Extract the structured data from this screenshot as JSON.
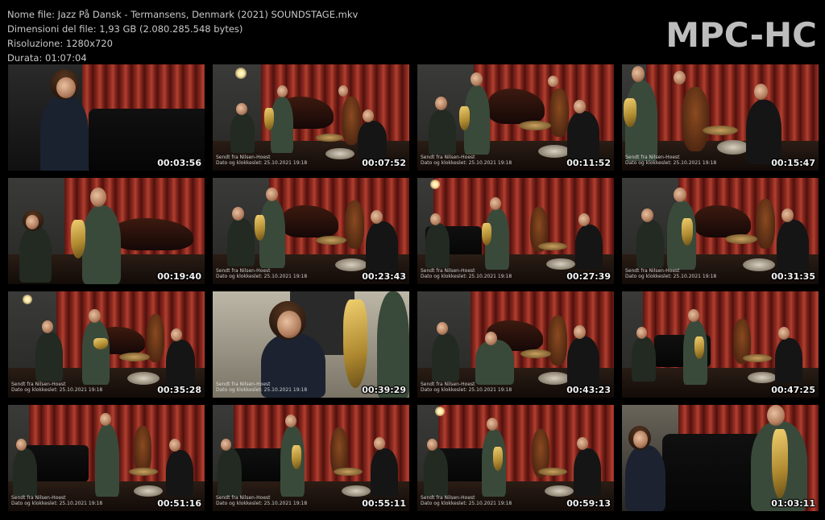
{
  "header": {
    "filename_line": "Nome file: Jazz På Dansk - Termansens, Denmark (2021) SOUNDSTAGE.mkv",
    "filesize_line": "Dimensioni del file: 1,93 GB (2.080.285.548 bytes)",
    "resolution_line": "Risoluzione: 1280x720",
    "duration_line": "Durata: 01:07:04"
  },
  "logo": {
    "text": "MPC-HC",
    "color": "#bdbdbd"
  },
  "thumbnails": [
    {
      "timestamp": "00:03:56"
    },
    {
      "timestamp": "00:07:52",
      "caption1": "Sendt fra Nilsen-Hoest",
      "caption2": "Dato og klokkeslet: 25.10.2021 19:18"
    },
    {
      "timestamp": "00:11:52",
      "caption1": "Sendt fra Nilsen-Hoest",
      "caption2": "Dato og klokkeslet: 25.10.2021 19:18"
    },
    {
      "timestamp": "00:15:47",
      "caption1": "Sendt fra Nilsen-Hoest",
      "caption2": "Dato og klokkeslet: 25.10.2021 19:18"
    },
    {
      "timestamp": "00:19:40"
    },
    {
      "timestamp": "00:23:43",
      "caption1": "Sendt fra Nilsen-Hoest",
      "caption2": "Dato og klokkeslet: 25.10.2021 19:18"
    },
    {
      "timestamp": "00:27:39",
      "caption1": "Sendt fra Nilsen-Hoest",
      "caption2": "Dato og klokkeslet: 25.10.2021 19:18"
    },
    {
      "timestamp": "00:31:35",
      "caption1": "Sendt fra Nilsen-Hoest",
      "caption2": "Dato og klokkeslet: 25.10.2021 19:18"
    },
    {
      "timestamp": "00:35:28",
      "caption1": "Sendt fra Nilsen-Hoest",
      "caption2": "Dato og klokkeslet: 25.10.2021 19:18"
    },
    {
      "timestamp": "00:39:29",
      "caption1": "Sendt fra Nilsen-Hoest",
      "caption2": "Dato og klokkeslet: 25.10.2021 19:18"
    },
    {
      "timestamp": "00:43:23",
      "caption1": "Sendt fra Nilsen-Hoest",
      "caption2": "Dato og klokkeslet: 25.10.2021 19:18"
    },
    {
      "timestamp": "00:47:25"
    },
    {
      "timestamp": "00:51:16",
      "caption1": "Sendt fra Nilsen-Hoest",
      "caption2": "Dato og klokkeslet: 25.10.2021 19:18"
    },
    {
      "timestamp": "00:55:11",
      "caption1": "Sendt fra Nilsen-Hoest",
      "caption2": "Dato og klokkeslet: 25.10.2021 19:18"
    },
    {
      "timestamp": "00:59:13",
      "caption1": "Sendt fra Nilsen-Hoest",
      "caption2": "Dato og klokkeslet: 25.10.2021 19:18"
    },
    {
      "timestamp": "01:03:11"
    }
  ]
}
